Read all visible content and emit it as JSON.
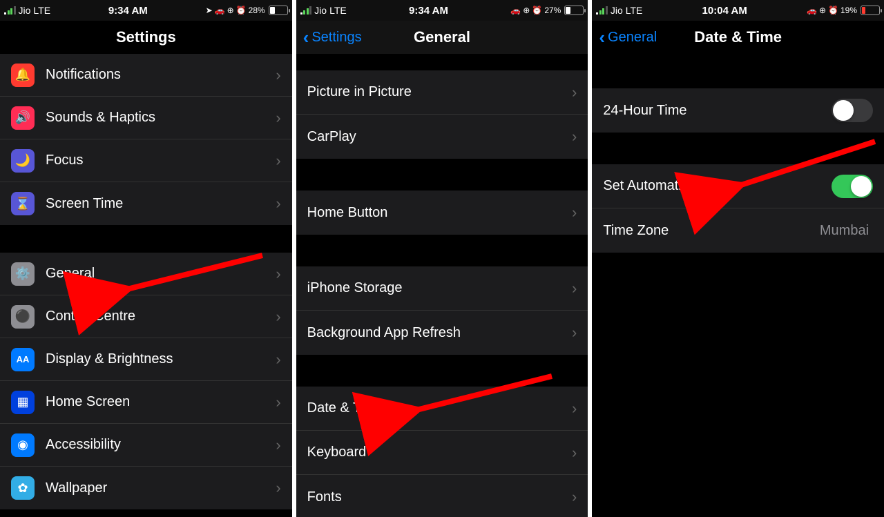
{
  "screen1": {
    "status": {
      "carrier": "Jio",
      "net": "LTE",
      "time": "9:34 AM",
      "battery_pct": "28%",
      "battery_level": 28
    },
    "title": "Settings",
    "groupA": [
      {
        "icon": "🔔",
        "bg": "bg-red",
        "label": "Notifications"
      },
      {
        "icon": "🔊",
        "bg": "bg-pink",
        "label": "Sounds & Haptics"
      },
      {
        "icon": "🌙",
        "bg": "bg-purple",
        "label": "Focus"
      },
      {
        "icon": "⌛",
        "bg": "bg-purple",
        "label": "Screen Time"
      }
    ],
    "groupB": [
      {
        "icon": "⚙️",
        "bg": "bg-gray",
        "label": "General"
      },
      {
        "icon": "⚫",
        "bg": "bg-gray",
        "label": "Control Centre"
      },
      {
        "icon": "AA",
        "bg": "bg-blue",
        "label": "Display & Brightness"
      },
      {
        "icon": "▦",
        "bg": "bg-darkblue",
        "label": "Home Screen"
      },
      {
        "icon": "◉",
        "bg": "bg-blue",
        "label": "Accessibility"
      },
      {
        "icon": "✿",
        "bg": "bg-teal",
        "label": "Wallpaper"
      }
    ]
  },
  "screen2": {
    "status": {
      "carrier": "Jio",
      "net": "LTE",
      "time": "9:34 AM",
      "battery_pct": "27%",
      "battery_level": 27
    },
    "back": "Settings",
    "title": "General",
    "groupA": [
      {
        "label": "Picture in Picture"
      },
      {
        "label": "CarPlay"
      }
    ],
    "groupB": [
      {
        "label": "Home Button"
      }
    ],
    "groupC": [
      {
        "label": "iPhone Storage"
      },
      {
        "label": "Background App Refresh"
      }
    ],
    "groupD": [
      {
        "label": "Date & Time"
      },
      {
        "label": "Keyboard"
      },
      {
        "label": "Fonts"
      }
    ]
  },
  "screen3": {
    "status": {
      "carrier": "Jio",
      "net": "LTE",
      "time": "10:04 AM",
      "battery_pct": "19%",
      "battery_level": 19
    },
    "back": "General",
    "title": "Date & Time",
    "row24h": {
      "label": "24-Hour Time",
      "on": false
    },
    "rowAuto": {
      "label": "Set Automatically",
      "on": true
    },
    "rowTz": {
      "label": "Time Zone",
      "detail": "Mumbai"
    }
  }
}
